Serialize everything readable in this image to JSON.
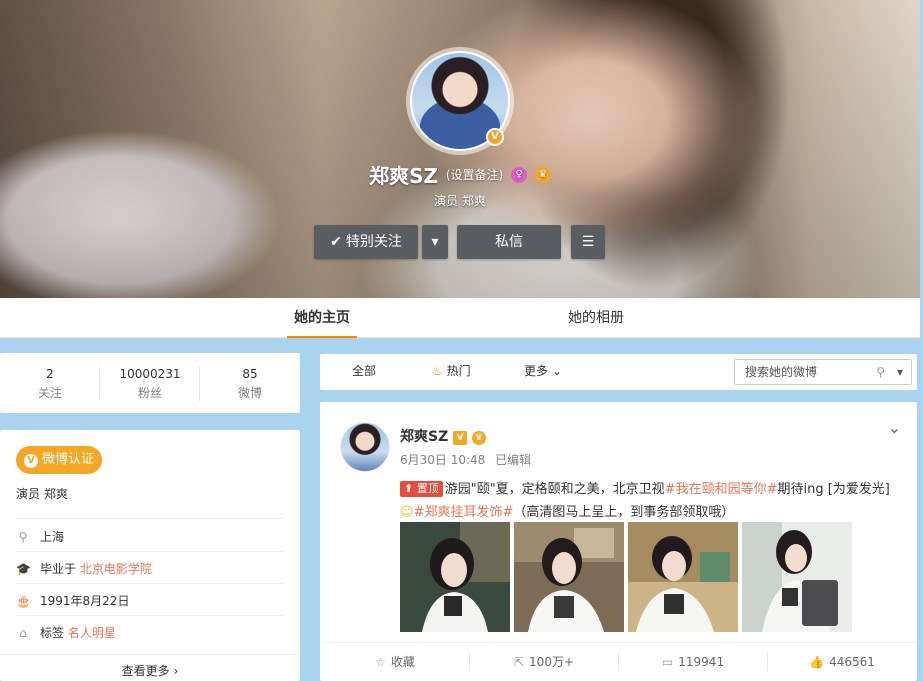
{
  "profile": {
    "name": "郑爽SZ",
    "remark": "(设置备注)",
    "subtitle": "演员 郑爽",
    "verified_badge": "V",
    "badge_color": "#f5a623"
  },
  "actions": {
    "follow_label": "特别关注",
    "message_label": "私信",
    "more_icon": "menu-icon",
    "dropdown_icon": "caret-down-icon"
  },
  "tabs": [
    {
      "label": "她的主页",
      "active": true
    },
    {
      "label": "她的相册",
      "active": false
    }
  ],
  "stats": [
    {
      "num": "2",
      "label": "关注"
    },
    {
      "num": "10000231",
      "label": "粉丝"
    },
    {
      "num": "85",
      "label": "微博"
    }
  ],
  "info": {
    "verify_label": "微博认证",
    "verify_text": "演员 郑爽",
    "location": "上海",
    "edu_prefix": "毕业于",
    "edu_link": "北京电影学院",
    "birthday": "1991年8月22日",
    "tags_prefix": "标签",
    "tags_link": "名人明星",
    "more": "查看更多",
    "more_arrow": "›"
  },
  "feed_toolbar": {
    "all": "全部",
    "hot": "热门",
    "more": "更多",
    "search_placeholder": "搜索她的微博",
    "accent": "#ff8200"
  },
  "post": {
    "author": "郑爽SZ",
    "date": "6月30日 10:48",
    "edited": "已编辑",
    "pin_label": "置顶",
    "text_1": "游园\"颐\"夏，定格颐和之美，北京卫视",
    "topic_1": "#我在颐和园等你#",
    "text_2": "期待ing [为爱发光]",
    "topic_2": "#郑爽挂耳发饰#",
    "text_3": "（高清图马上呈上，到事务部领取哦）",
    "photo_count": 4,
    "actions": [
      {
        "icon": "star-icon",
        "label": "收藏"
      },
      {
        "icon": "share-icon",
        "label": "100万+"
      },
      {
        "icon": "comment-icon",
        "label": "119941"
      },
      {
        "icon": "like-icon",
        "label": "446561"
      }
    ],
    "link_color": "#eb7350"
  }
}
